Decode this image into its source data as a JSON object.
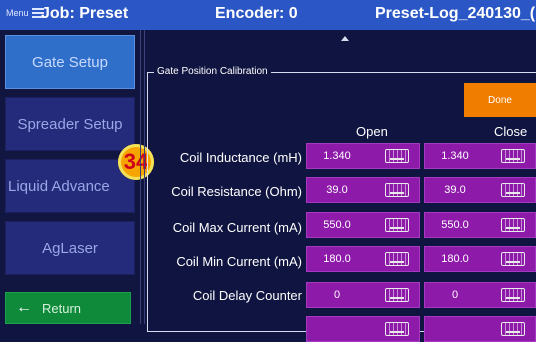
{
  "header": {
    "menu_label": "Menu",
    "job": "Job: Preset",
    "encoder": "Encoder: 0",
    "preset": "Preset-Log_240130_("
  },
  "sidebar": {
    "items": [
      {
        "label": "Gate Setup"
      },
      {
        "label": "Spreader Setup"
      },
      {
        "label": "Liquid Advance"
      },
      {
        "label": "AgLaser"
      }
    ],
    "return_label": "Return"
  },
  "badge": "34",
  "panel": {
    "legend": "Gate Position Calibration",
    "done_label": "Done",
    "col_open": "Open",
    "col_close": "Close",
    "rows": [
      {
        "label": "Coil Inductance (mH)",
        "open": "1.340",
        "close": "1.340"
      },
      {
        "label": "Coil Resistance (Ohm)",
        "open": "39.0",
        "close": "39.0"
      },
      {
        "label": "Coil Max Current (mA)",
        "open": "550.0",
        "close": "550.0"
      },
      {
        "label": "Coil Min Current (mA)",
        "open": "180.0",
        "close": "180.0"
      },
      {
        "label": "Coil Delay Counter",
        "open": "0",
        "close": "0"
      },
      {
        "label": "",
        "open": "",
        "close": ""
      }
    ]
  }
}
